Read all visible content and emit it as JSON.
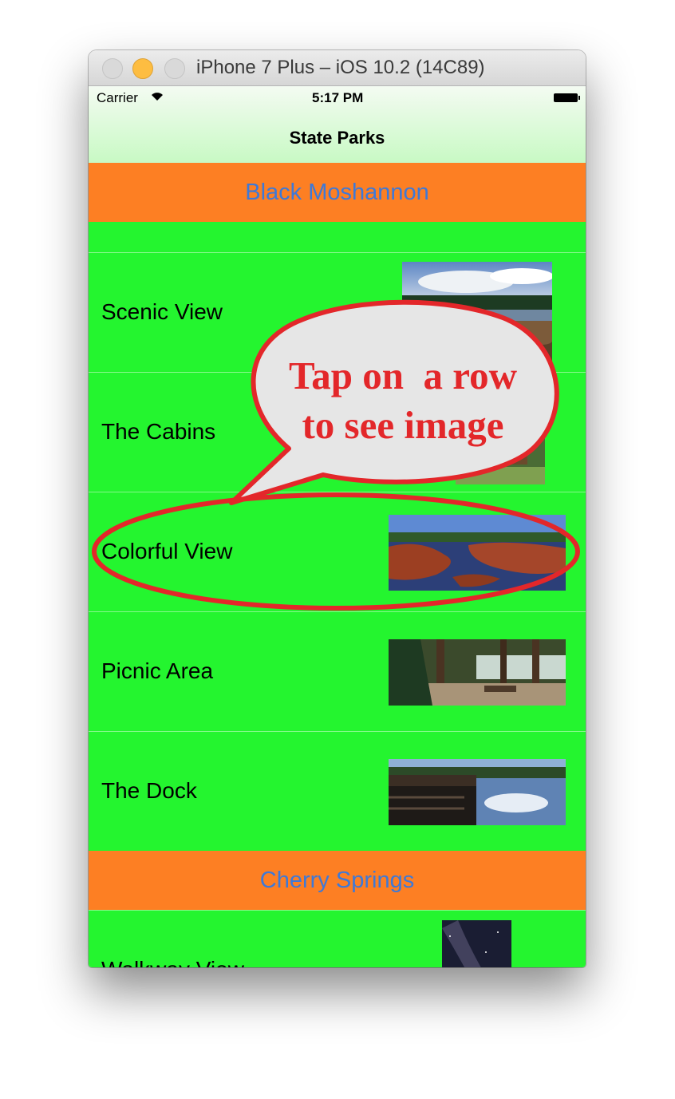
{
  "window": {
    "title": "iPhone 7 Plus – iOS 10.2 (14C89)"
  },
  "status_bar": {
    "carrier": "Carrier",
    "time": "5:17 PM"
  },
  "nav": {
    "title": "State Parks"
  },
  "sections": [
    {
      "title": "Black Moshannon",
      "rows": [
        {
          "label": "Scenic View"
        },
        {
          "label": "The Cabins"
        },
        {
          "label": "Colorful View"
        },
        {
          "label": "Picnic Area"
        },
        {
          "label": "The Dock"
        }
      ]
    },
    {
      "title": "Cherry Springs",
      "rows": [
        {
          "label": "Walkway View"
        }
      ]
    }
  ],
  "callout": {
    "line1": "Tap on  a row",
    "line2": "to see image"
  },
  "colors": {
    "table_bg": "#24f52f",
    "section_bg": "#fd7f23",
    "section_text": "#3d79d8",
    "callout_red": "#e3272a"
  }
}
